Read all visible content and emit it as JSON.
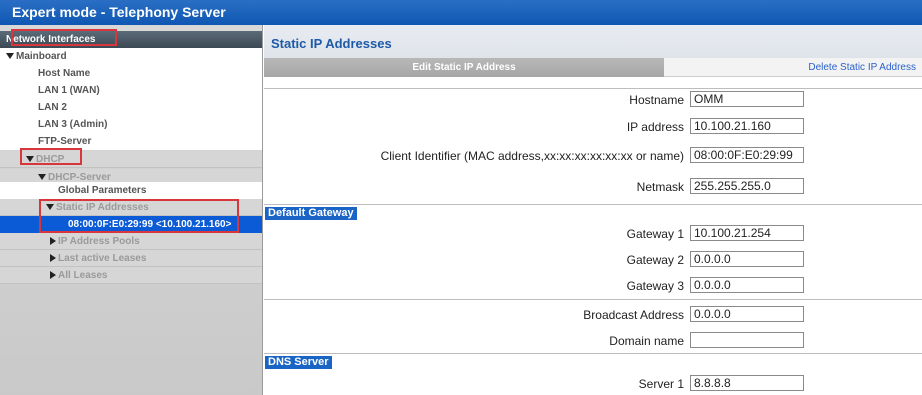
{
  "window": {
    "title": "Expert mode - Telephony Server"
  },
  "sidebar": {
    "header": "Network Interfaces",
    "mainboard": "Mainboard",
    "host_name": "Host Name",
    "lan1": "LAN 1 (WAN)",
    "lan2": "LAN 2",
    "lan3": "LAN 3 (Admin)",
    "ftp": "FTP-Server",
    "dhcp": "DHCP",
    "dhcp_server": "DHCP-Server",
    "global_params": "Global Parameters",
    "static_ip": "Static IP Addresses",
    "static_entry": "08:00:0F:E0:29:99 <10.100.21.160>",
    "ip_pools": "IP Address Pools",
    "last_leases": "Last active Leases",
    "all_leases": "All Leases"
  },
  "main": {
    "title": "Static IP Addresses",
    "tab_edit": "Edit Static IP Address",
    "tab_delete": "Delete Static IP Address",
    "sections": {
      "gateway": "Default Gateway",
      "dns": "DNS Server"
    },
    "fields": {
      "hostname": {
        "label": "Hostname",
        "value": "OMM"
      },
      "ip": {
        "label": "IP address",
        "value": "10.100.21.160"
      },
      "client_id": {
        "label": "Client Identifier (MAC address,xx:xx:xx:xx:xx:xx or name)",
        "value": "08:00:0F:E0:29:99"
      },
      "netmask": {
        "label": "Netmask",
        "value": "255.255.255.0"
      },
      "gateway1": {
        "label": "Gateway 1",
        "value": "10.100.21.254"
      },
      "gateway2": {
        "label": "Gateway 2",
        "value": "0.0.0.0"
      },
      "gateway3": {
        "label": "Gateway 3",
        "value": "0.0.0.0"
      },
      "broadcast": {
        "label": "Broadcast Address",
        "value": "0.0.0.0"
      },
      "domain": {
        "label": "Domain name",
        "value": ""
      },
      "server1": {
        "label": "Server 1",
        "value": "8.8.8.8"
      }
    }
  },
  "colors": {
    "accent": "#1a64c6",
    "highlight": "#d6363c",
    "selected": "#0c5bd6"
  }
}
